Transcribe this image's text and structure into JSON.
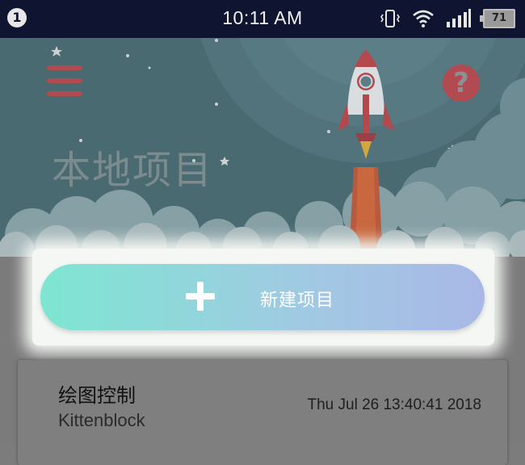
{
  "status_bar": {
    "notification_count": "1",
    "time": "10:11 AM",
    "battery": "71",
    "icons": [
      "vibrate-icon",
      "wifi-icon",
      "signal-icon",
      "battery-icon"
    ]
  },
  "header": {
    "title": "本地项目",
    "help_label": "?",
    "icons": [
      "menu-icon",
      "help-icon",
      "rocket-illustration"
    ]
  },
  "new_project": {
    "label": "新建项目",
    "icon": "plus-icon"
  },
  "projects": [
    {
      "name": "绘图控制",
      "author": "Kittenblock",
      "modified": "Thu Jul 26 13:40:41 2018"
    }
  ],
  "colors": {
    "status_bar": "#0f1530",
    "accent_red": "#b24a52",
    "button_gradient_start": "#7ee6d2",
    "button_gradient_end": "#a9b8e6"
  }
}
